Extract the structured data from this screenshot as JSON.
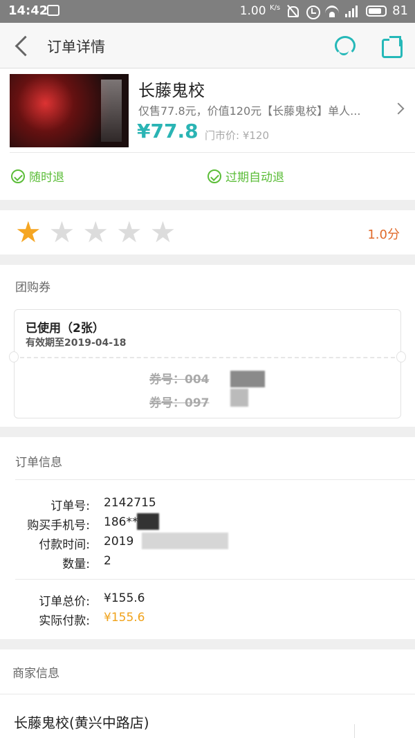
{
  "statusbar": {
    "time": "14:42",
    "speed": "1.00",
    "speed_unit": "K/s",
    "battery": "81"
  },
  "header": {
    "title": "订单详情"
  },
  "product": {
    "name": "长藤鬼校",
    "desc": "仅售77.8元，价值120元【长藤鬼校】单人...",
    "price": "¥77.8",
    "market_price": "门市价: ¥120",
    "tags": [
      "随时退",
      "过期自动退"
    ]
  },
  "rating": {
    "stars": 1,
    "max_stars": 5,
    "score": "1.0分",
    "colors": {
      "on": "#f5a623",
      "off": "#dcdcdc"
    }
  },
  "coupons": {
    "title": "团购券",
    "status": "已使用（2张）",
    "valid": "有效期至2019-04-18",
    "codes": [
      "券号：004",
      "券号：097"
    ]
  },
  "order": {
    "title": "订单信息",
    "rows": [
      {
        "label": "订单号:",
        "value": "2142715"
      },
      {
        "label": "购买手机号:",
        "value": "186****"
      },
      {
        "label": "付款时间:",
        "value": "2019"
      },
      {
        "label": "数量:",
        "value": "2"
      }
    ],
    "total_label": "订单总价:",
    "total": "¥155.6",
    "paid_label": "实际付款:",
    "paid": "¥155.6"
  },
  "merchant": {
    "title": "商家信息",
    "name": "长藤鬼校(黄兴中路店)"
  },
  "colors": {
    "accent": "#2ab4b4",
    "green": "#5bbd38",
    "orange": "#f0a21a"
  }
}
